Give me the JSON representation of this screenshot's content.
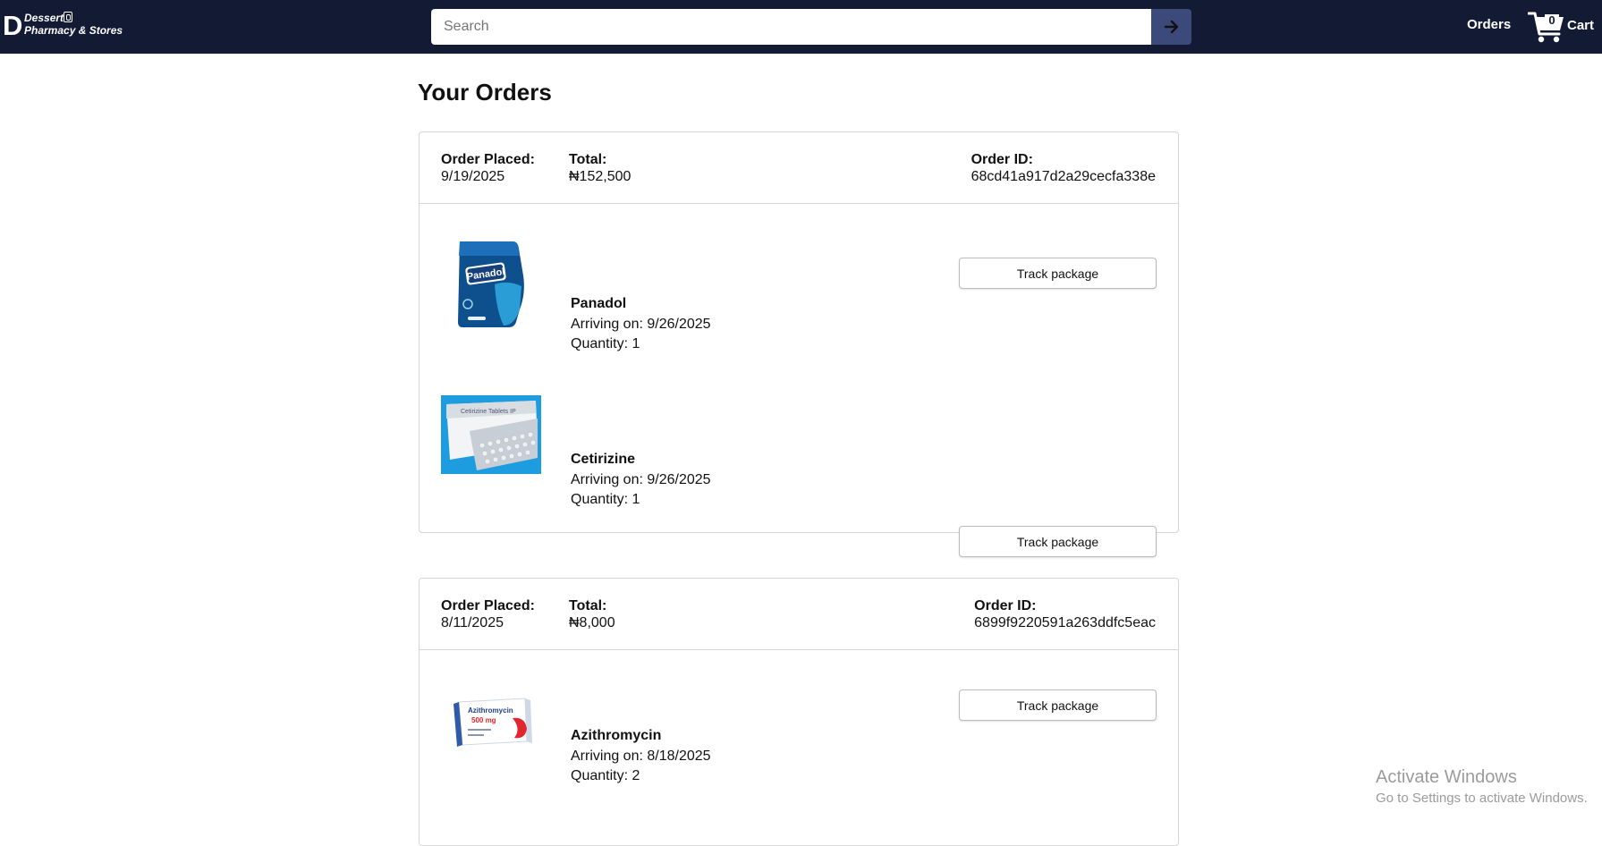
{
  "header": {
    "logo": {
      "letter": "D",
      "line1": "Dessert",
      "line2": "Pharmacy & Stores"
    },
    "search": {
      "placeholder": "Search",
      "value": "",
      "submit_icon": "arrow-right-icon"
    },
    "nav": {
      "orders_label": "Orders"
    },
    "cart": {
      "count": "0",
      "label": "Cart",
      "icon": "cart-icon"
    }
  },
  "page": {
    "title": "Your Orders"
  },
  "orders": [
    {
      "placed_label": "Order Placed:",
      "placed_date": "9/19/2025",
      "total_label": "Total:",
      "total": "₦152,500",
      "id_label": "Order ID:",
      "id": "68cd41a917d2a29cecfa338e",
      "items": [
        {
          "name": "Panadol",
          "arriving": "Arriving on: 9/26/2025",
          "quantity": "Quantity: 1",
          "button": "Track package"
        },
        {
          "name": "Cetirizine",
          "arriving": "Arriving on: 9/26/2025",
          "quantity": "Quantity: 1",
          "button": "Track package"
        }
      ]
    },
    {
      "placed_label": "Order Placed:",
      "placed_date": "8/11/2025",
      "total_label": "Total:",
      "total": "₦8,000",
      "id_label": "Order ID:",
      "id": "6899f9220591a263ddfc5eac",
      "items": [
        {
          "name": "Azithromycin",
          "arriving": "Arriving on: 8/18/2025",
          "quantity": "Quantity: 2",
          "button": "Track package"
        }
      ]
    }
  ],
  "product_art": {
    "panadol_box_text": "Panadol",
    "cetirizine_box_text": "Cetirizine Tablets IP",
    "azithromycin_box_text": "Azithromycin",
    "azithromycin_dose": "500 mg"
  },
  "watermark": {
    "line1": "Activate Windows",
    "line2": "Go to Settings to activate Windows."
  },
  "colors": {
    "header_bg": "#131a33",
    "search_button_bg": "#3b4a7a",
    "border": "#d6d6d6"
  }
}
